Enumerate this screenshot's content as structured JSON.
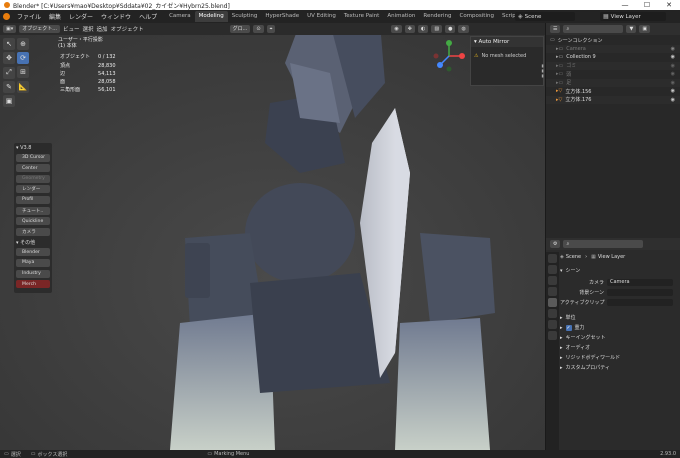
{
  "window": {
    "title": "Blender* [C:¥Users¥mao¥Desktop¥Sddata¥02_カイゼン¥Hybrn25.blend]",
    "minimize": "—",
    "maximize": "☐",
    "close": "✕"
  },
  "menu": {
    "items": [
      "ファイル",
      "編集",
      "レンダー",
      "ウィンドウ",
      "ヘルプ"
    ]
  },
  "workspaces": [
    "Camera",
    "Modeling",
    "Sculpting",
    "HyperShade",
    "UV Editing",
    "Texture Paint",
    "Animation",
    "Rendering",
    "Compositing",
    "Scripting"
  ],
  "scene_selector": {
    "label": "Scene",
    "view_layer": "View Layer"
  },
  "viewport_header": {
    "mode": "オブジェクト...",
    "items": [
      "ビュー",
      "選択",
      "追加",
      "オブジェクト"
    ],
    "transform": "グロ..."
  },
  "view_info": {
    "title": "ユーザー・平行投影",
    "subtitle": "(1) 本体"
  },
  "stats": [
    {
      "label": "オブジェクト",
      "value": "0 / 132"
    },
    {
      "label": "頂点",
      "value": "28,830"
    },
    {
      "label": "辺",
      "value": "54,113"
    },
    {
      "label": "面",
      "value": "28,058"
    },
    {
      "label": "三角形面",
      "value": "56,101"
    }
  ],
  "side_panel": {
    "header": "V3.8",
    "buttons": [
      {
        "label": "3D Cursor",
        "dim": false
      },
      {
        "label": "Center",
        "dim": false
      },
      {
        "label": "Geometry",
        "dim": true
      },
      {
        "label": "レンダー",
        "dim": false
      },
      {
        "label": "Profil",
        "dim": false
      },
      {
        "label": "チュート..",
        "dim": false
      },
      {
        "label": "Quickline",
        "dim": false
      },
      {
        "label": "カメラ",
        "dim": false
      }
    ],
    "other_header": "その他",
    "other_buttons": [
      "Blender",
      "Maya",
      "Industry",
      "Merch"
    ]
  },
  "auto_mirror": {
    "title": "Auto Mirror",
    "message": "No mesh selected"
  },
  "outliner": {
    "header": "シーンコレクション",
    "rows": [
      {
        "label": "Camera",
        "dim": true
      },
      {
        "label": "Collection 9",
        "dim": false
      },
      {
        "label": "ゴミ",
        "dim": true
      },
      {
        "label": "頭",
        "dim": true
      },
      {
        "label": "足",
        "dim": true
      },
      {
        "label": "立方体.156",
        "dim": false
      },
      {
        "label": "立方体.176",
        "dim": false
      }
    ]
  },
  "properties": {
    "section": "シーン",
    "camera_label": "カメラ",
    "camera_value": "Camera",
    "bg_scene_label": "背景シーン",
    "active_clip_label": "アクティブクリップ",
    "subsections": [
      "単位",
      "重力",
      "キーイングセット",
      "オーディオ",
      "リジッドボディワールド",
      "カスタムプロパティ"
    ],
    "gravity_checked": true
  },
  "status": {
    "left": "選択",
    "mid": "ボックス選択",
    "mid2": "Marking Menu",
    "version": "2.93.0"
  }
}
